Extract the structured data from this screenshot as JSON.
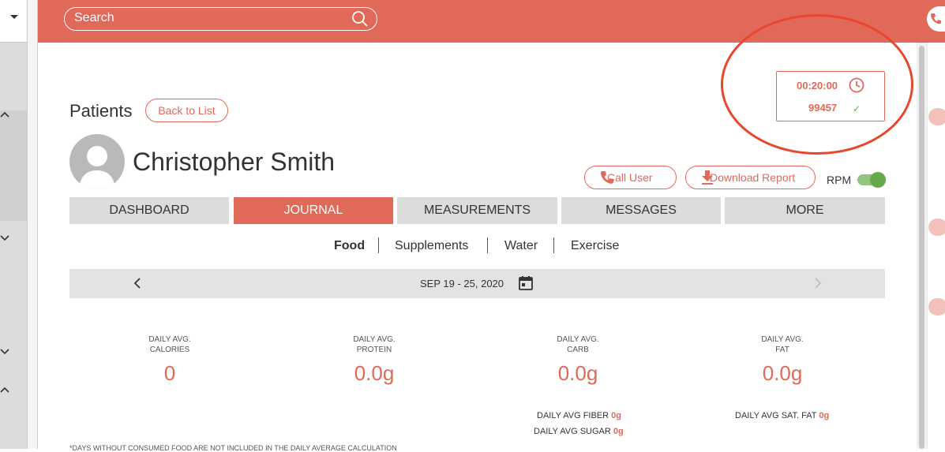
{
  "header": {
    "search_placeholder": "Search"
  },
  "timer": {
    "time": "00:20:00",
    "code": "99457",
    "check": "✓"
  },
  "patient": {
    "section_title": "Patients",
    "back_label": "Back to List",
    "name": "Christopher Smith"
  },
  "actions": {
    "call_label": "Call User",
    "download_label": "Download Report",
    "rpm_label": "RPM",
    "rpm_enabled": true
  },
  "tabs": [
    {
      "label": "DASHBOARD",
      "active": false
    },
    {
      "label": "JOURNAL",
      "active": true
    },
    {
      "label": "MEASUREMENTS",
      "active": false
    },
    {
      "label": "MESSAGES",
      "active": false
    },
    {
      "label": "MORE",
      "active": false
    }
  ],
  "subtabs": [
    {
      "label": "Food",
      "active": true
    },
    {
      "label": "Supplements",
      "active": false
    },
    {
      "label": "Water",
      "active": false
    },
    {
      "label": "Exercise",
      "active": false
    }
  ],
  "date_range": "SEP 19 - 25, 2020",
  "stats": [
    {
      "label1": "DAILY AVG.",
      "label2": "CALORIES",
      "value": "0"
    },
    {
      "label1": "DAILY AVG.",
      "label2": "PROTEIN",
      "value": "0.0g"
    },
    {
      "label1": "DAILY AVG.",
      "label2": "CARB",
      "value": "0.0g"
    },
    {
      "label1": "DAILY AVG.",
      "label2": "FAT",
      "value": "0.0g"
    }
  ],
  "extras": {
    "fiber_label": "DAILY AVG FIBER ",
    "fiber_value": "0g",
    "sugar_label": "DAILY AVG SUGAR ",
    "sugar_value": "0g",
    "satfat_label": "DAILY AVG SAT. FAT ",
    "satfat_value": "0g"
  },
  "footnote": "*DAYS WITHOUT CONSUMED FOOD ARE NOT INCLUDED IN THE DAILY AVERAGE CALCULATION",
  "colors": {
    "accent": "#e0695a",
    "toggle_on": "#67a84a",
    "annotation": "#e8462d"
  }
}
